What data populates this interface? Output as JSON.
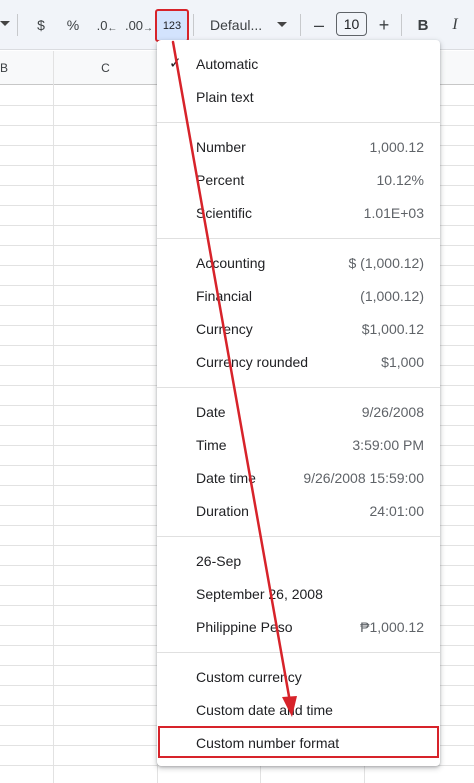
{
  "toolbar": {
    "currency": "$",
    "percent": "%",
    "decrease_decimal": ".0",
    "increase_decimal": ".00",
    "number_format": "123",
    "font": "Defaul...",
    "minus": "–",
    "font_size": "10",
    "plus": "+",
    "bold": "B",
    "italic": "I"
  },
  "columns": [
    "B",
    "C"
  ],
  "menu": {
    "items": [
      {
        "label": "Automatic",
        "value": "",
        "checked": true
      },
      {
        "label": "Plain text",
        "value": ""
      },
      {
        "label": "Number",
        "value": "1,000.12"
      },
      {
        "label": "Percent",
        "value": "10.12%"
      },
      {
        "label": "Scientific",
        "value": "1.01E+03"
      },
      {
        "label": "Accounting",
        "value": "$ (1,000.12)"
      },
      {
        "label": "Financial",
        "value": "(1,000.12)"
      },
      {
        "label": "Currency",
        "value": "$1,000.12"
      },
      {
        "label": "Currency rounded",
        "value": "$1,000"
      },
      {
        "label": "Date",
        "value": "9/26/2008"
      },
      {
        "label": "Time",
        "value": "3:59:00 PM"
      },
      {
        "label": "Date time",
        "value": "9/26/2008 15:59:00"
      },
      {
        "label": "Duration",
        "value": "24:01:00"
      },
      {
        "label": "26-Sep",
        "value": ""
      },
      {
        "label": "September 26, 2008",
        "value": ""
      },
      {
        "label": "Philippine Peso",
        "value": "₱1,000.12"
      },
      {
        "label": "Custom currency",
        "value": ""
      },
      {
        "label": "Custom date and time",
        "value": ""
      },
      {
        "label": "Custom number format",
        "value": ""
      }
    ]
  },
  "check_mark": "✓",
  "colors": {
    "highlight_red": "#d7232a",
    "format_button_bg": "#d3e3fd",
    "toolbar_bg": "#f1f4f9"
  }
}
